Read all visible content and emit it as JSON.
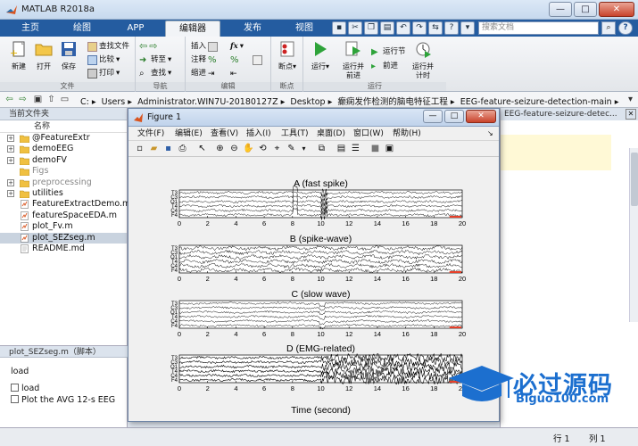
{
  "window": {
    "title": "MATLAB R2018a",
    "min": "—",
    "max": "□",
    "close": "✕"
  },
  "tabs": [
    "主页",
    "绘图",
    "APP",
    "编辑器",
    "发布",
    "视图"
  ],
  "active_tab": "编辑器",
  "search": {
    "placeholder": "搜索文档"
  },
  "ribbon": {
    "file": {
      "label": "文件",
      "new": "新建",
      "open": "打开",
      "save": "保存",
      "find_files": "查找文件",
      "compare": "比较",
      "print": "打印"
    },
    "nav": {
      "label": "导航",
      "goto": "转至",
      "find": "查找"
    },
    "edit": {
      "label": "编辑",
      "insert": "插入",
      "comment": "注释",
      "indent": "缩进",
      "fx": "fx"
    },
    "breakpoints": {
      "label": "断点",
      "btn": "断点"
    },
    "run": {
      "label": "运行",
      "run": "运行",
      "run_advance": "运行并\n前进",
      "run_section": "运行节",
      "advance": "前进",
      "run_time": "运行并\n计时"
    }
  },
  "address": {
    "crumbs": [
      "C:",
      "Users",
      "Administrator.WIN7U-20180127Z",
      "Desktop",
      "癫痫发作检测的脑电特征工程",
      "EEG-feature-seizure-detection-main"
    ]
  },
  "left_panel": {
    "header": "当前文件夹",
    "col": "名称",
    "files": [
      {
        "name": "@FeatureExtr",
        "type": "folder",
        "exp": "+"
      },
      {
        "name": "demoEEG",
        "type": "folder",
        "exp": "+"
      },
      {
        "name": "demoFV",
        "type": "folder",
        "exp": "+"
      },
      {
        "name": "Figs",
        "type": "folder",
        "exp": "",
        "dim": true
      },
      {
        "name": "preprocessing",
        "type": "folder",
        "exp": "+",
        "dim": true
      },
      {
        "name": "utilities",
        "type": "folder",
        "exp": "+"
      },
      {
        "name": "FeatureExtractDemo.m",
        "type": "mfile",
        "exp": ""
      },
      {
        "name": "featureSpaceEDA.m",
        "type": "mfile",
        "exp": ""
      },
      {
        "name": "plot_Fv.m",
        "type": "mfile",
        "exp": ""
      },
      {
        "name": "plot_SEZseg.m",
        "type": "mfile",
        "exp": "",
        "selected": true
      },
      {
        "name": "README.md",
        "type": "doc",
        "exp": ""
      }
    ]
  },
  "details": {
    "header": "plot_SEZseg.m（脚本）",
    "title": "load",
    "items": [
      "load",
      "Plot the AVG 12-s EEG"
    ]
  },
  "right_panel": {
    "path_tail": "EEG-feature-seizure-detec..."
  },
  "status": {
    "row": "行 1",
    "col": "列 1"
  },
  "figure": {
    "title": "Figure 1",
    "menu": [
      "文件(F)",
      "编辑(E)",
      "查看(V)",
      "插入(I)",
      "工具(T)",
      "桌面(D)",
      "窗口(W)",
      "帮助(H)"
    ],
    "xlabel": "Time (second)"
  },
  "chart_data": {
    "type": "line",
    "panels": [
      {
        "title": "A (fast spike)"
      },
      {
        "title": "B (spike-wave)"
      },
      {
        "title": "C (slow wave)"
      },
      {
        "title": "D (EMG-related)"
      }
    ],
    "channels": [
      "T3",
      "C3",
      "O1",
      "T4",
      "C4",
      "F4"
    ],
    "xlim": [
      0,
      20
    ],
    "xticks": [
      0,
      2,
      4,
      6,
      8,
      10,
      12,
      14,
      16,
      18,
      20
    ],
    "xlabel": "Time (second)",
    "trace_color": "#000000",
    "scale_bar_color": "#e8402a"
  },
  "watermark": {
    "line1": "必过源码",
    "line2": "Biguo100.com"
  }
}
